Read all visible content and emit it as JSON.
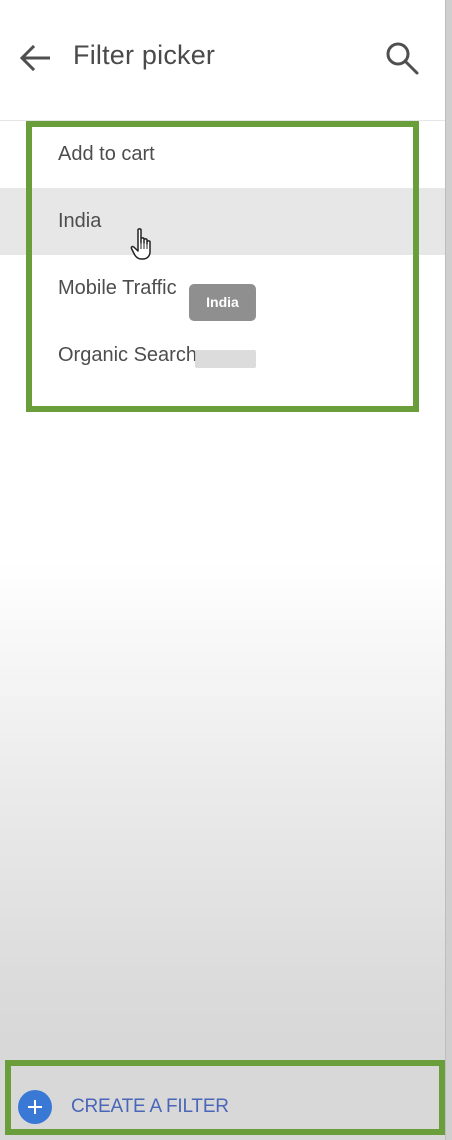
{
  "header": {
    "back_icon": "arrow-left-icon",
    "title": "Filter picker",
    "search_icon": "search-icon"
  },
  "filters": [
    {
      "label": "Add to cart"
    },
    {
      "label": "India"
    },
    {
      "label": "Mobile Traffic"
    },
    {
      "label": "Organic Search"
    }
  ],
  "hovered_item": "India",
  "tooltip": {
    "text": "India"
  },
  "footer": {
    "create_label": "CREATE A FILTER",
    "create_icon": "plus-circle-icon"
  },
  "colors": {
    "highlight": "#6a9e3a",
    "accent": "#3a78d6",
    "create_text": "#4a66b8"
  }
}
